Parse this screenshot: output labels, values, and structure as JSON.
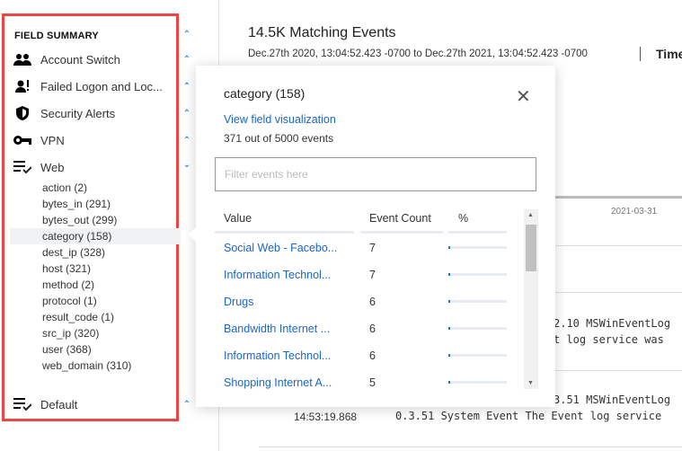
{
  "sidebar": {
    "heading": "FIELD SUMMARY",
    "groups": [
      {
        "label": "Account Switch",
        "icon": "users-icon",
        "expanded": false
      },
      {
        "label": "Failed Logon and Loc...",
        "icon": "user-alert-icon",
        "expanded": false
      },
      {
        "label": "Security Alerts",
        "icon": "shield-icon",
        "expanded": false
      },
      {
        "label": "VPN",
        "icon": "key-icon",
        "expanded": false
      },
      {
        "label": "Web",
        "icon": "list-check-icon",
        "expanded": true
      }
    ],
    "fields": [
      "action (2)",
      "bytes_in (291)",
      "bytes_out (299)",
      "category (158)",
      "dest_ip (328)",
      "host (321)",
      "method (2)",
      "protocol (1)",
      "result_code (1)",
      "src_ip (320)",
      "user (368)",
      "web_domain (310)"
    ],
    "selected_field": "category (158)",
    "default_group": {
      "label": "Default",
      "icon": "list-check-icon"
    }
  },
  "main": {
    "title": "14.5K Matching Events",
    "range": "Dec.27th 2020, 13:04:52.423 -0700 to Dec.27th 2021, 13:04:52.423 -0700",
    "time_label": "Time",
    "axis_tick": "2021-03-31",
    "log_lines": [
      "2.10 MSWinEventLog",
      "t log service was",
      "3.51 MSWinEventLog",
      "14:53:19.868",
      "0.3.51 System Event The Event log service"
    ]
  },
  "popover": {
    "title": "category (158)",
    "link": "View field visualization",
    "count_text": "371 out of 5000 events",
    "filter_placeholder": "Filter events here",
    "columns": [
      "Value",
      "Event Count",
      "%"
    ],
    "rows": [
      {
        "value": "Social Web - Facebo...",
        "count": "7",
        "pct": 1.9
      },
      {
        "value": "Information Technol...",
        "count": "7",
        "pct": 1.9
      },
      {
        "value": "Drugs",
        "count": "6",
        "pct": 1.6
      },
      {
        "value": "Bandwidth Internet ...",
        "count": "6",
        "pct": 1.6
      },
      {
        "value": "Information Technol...",
        "count": "6",
        "pct": 1.6
      },
      {
        "value": "Shopping Internet A...",
        "count": "5",
        "pct": 1.3
      }
    ]
  },
  "colors": {
    "accent": "#1a66c9",
    "highlight_border": "#ef4444"
  }
}
